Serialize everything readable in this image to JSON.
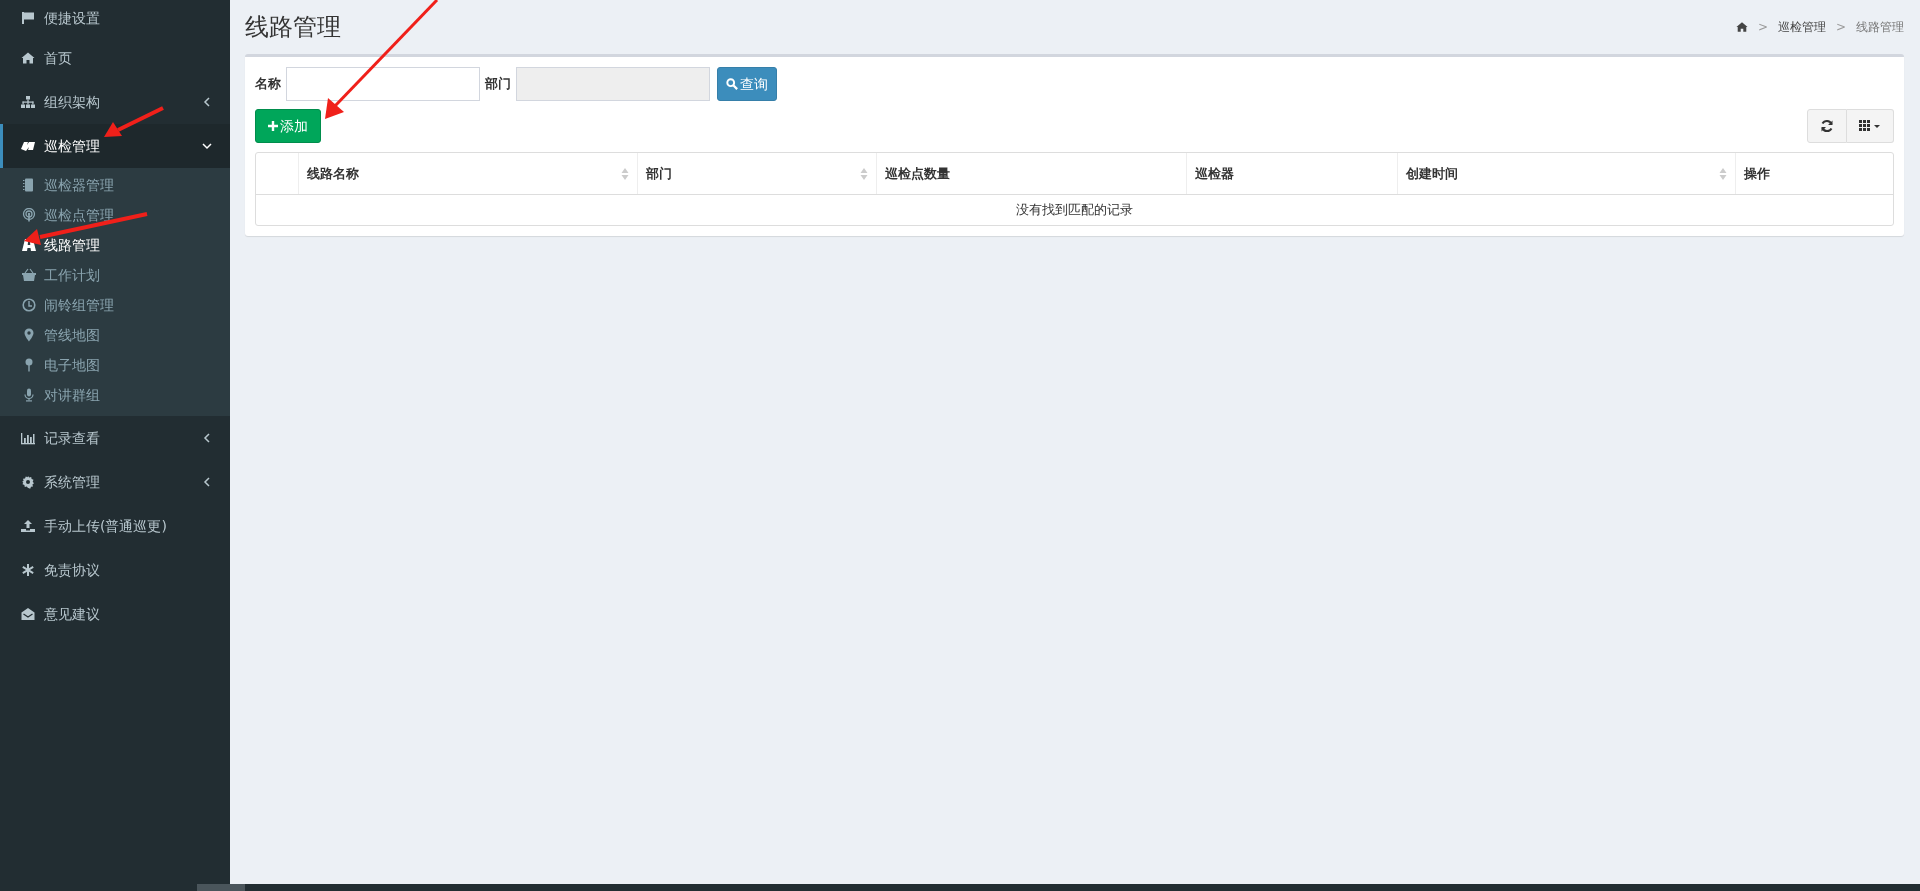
{
  "sidebar": {
    "items": [
      {
        "label": "便捷设置",
        "selected": false
      },
      {
        "label": "首页",
        "selected": false
      },
      {
        "label": "组织架构",
        "selected": false,
        "expanded": false
      },
      {
        "label": "巡检管理",
        "selected": true,
        "expanded": true,
        "children": [
          {
            "label": "巡检器管理",
            "selected": false
          },
          {
            "label": "巡检点管理",
            "selected": false
          },
          {
            "label": "线路管理",
            "selected": true
          },
          {
            "label": "工作计划",
            "selected": false
          },
          {
            "label": "闹铃组管理",
            "selected": false
          },
          {
            "label": "管线地图",
            "selected": false
          },
          {
            "label": "电子地图",
            "selected": false
          },
          {
            "label": "对讲群组",
            "selected": false
          }
        ]
      },
      {
        "label": "记录查看",
        "selected": false,
        "expanded": false
      },
      {
        "label": "系统管理",
        "selected": false,
        "expanded": false
      },
      {
        "label": "手动上传(普通巡更)",
        "selected": false
      },
      {
        "label": "免责协议",
        "selected": false
      },
      {
        "label": "意见建议",
        "selected": false
      }
    ]
  },
  "page_header": {
    "title": "线路管理",
    "breadcrumb": [
      {
        "kind": "home"
      },
      {
        "kind": "separator",
        "text": ">"
      },
      {
        "kind": "link",
        "text": "巡检管理"
      },
      {
        "kind": "separator",
        "text": ">"
      },
      {
        "kind": "current",
        "text": "线路管理"
      }
    ]
  },
  "filters": [
    {
      "label": "名称",
      "disabled": false
    },
    {
      "label": "部门",
      "disabled": true
    }
  ],
  "query_button": "查询",
  "add_button": "添加",
  "table": {
    "columns": [
      {
        "kind": "checkbox"
      },
      {
        "kind": "text",
        "label": "线路名称",
        "sortable": true
      },
      {
        "kind": "text",
        "label": "部门",
        "sortable": true
      },
      {
        "kind": "text",
        "label": "巡检点数量",
        "sortable": false
      },
      {
        "kind": "text",
        "label": "巡检器",
        "sortable": false
      },
      {
        "kind": "text",
        "label": "创建时间",
        "sortable": true
      },
      {
        "kind": "text",
        "label": "操作",
        "sortable": false
      }
    ],
    "empty_message": "没有找到匹配的记录"
  }
}
